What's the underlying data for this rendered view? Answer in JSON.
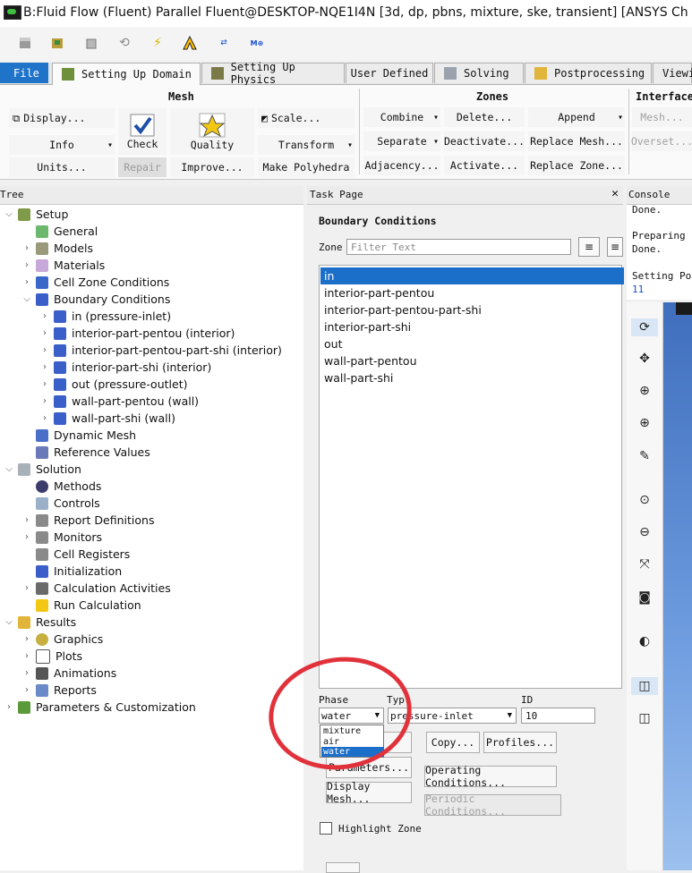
{
  "window": {
    "title": "B:Fluid Flow (Fluent) Parallel Fluent@DESKTOP-NQE1I4N  [3d, dp, pbns, mixture, ske, transient] [ANSYS Ch"
  },
  "quick_toolbar": {
    "icons": [
      "open-case-icon",
      "save-icon",
      "cube-icon",
      "refresh-icon",
      "lightning-icon",
      "ansys-icon",
      "parallel-icon",
      "moe-icon"
    ]
  },
  "tabs": [
    {
      "label": "File"
    },
    {
      "label": "Setting Up Domain"
    },
    {
      "label": "Setting Up Physics"
    },
    {
      "label": "User Defined"
    },
    {
      "label": "Solving"
    },
    {
      "label": "Postprocessing"
    },
    {
      "label": "Viewi"
    }
  ],
  "ribbon": {
    "mesh": {
      "title": "Mesh",
      "display": "Display...",
      "info": "Info",
      "units": "Units...",
      "check": "Check",
      "repair": "Repair",
      "quality": "Quality",
      "improve": "Improve...",
      "scale": "Scale...",
      "transform": "Transform",
      "make_polyhedra": "Make Polyhedra"
    },
    "zones": {
      "title": "Zones",
      "combine": "Combine",
      "separate": "Separate",
      "adjacency": "Adjacency...",
      "delete": "Delete...",
      "deactivate": "Deactivate...",
      "activate": "Activate...",
      "append": "Append",
      "replace_mesh": "Replace Mesh...",
      "replace_zone": "Replace Zone..."
    },
    "interface": {
      "title": "Interface",
      "mesh": "Mesh...",
      "overset": "Overset..."
    }
  },
  "tree": {
    "header": "Tree",
    "nodes": [
      {
        "label": "Setup"
      },
      {
        "label": "General"
      },
      {
        "label": "Models"
      },
      {
        "label": "Materials"
      },
      {
        "label": "Cell Zone Conditions"
      },
      {
        "label": "Boundary Conditions"
      },
      {
        "label": "in (pressure-inlet)"
      },
      {
        "label": "interior-part-pentou (interior)"
      },
      {
        "label": "interior-part-pentou-part-shi (interior)"
      },
      {
        "label": "interior-part-shi (interior)"
      },
      {
        "label": "out (pressure-outlet)"
      },
      {
        "label": "wall-part-pentou (wall)"
      },
      {
        "label": "wall-part-shi (wall)"
      },
      {
        "label": "Dynamic Mesh"
      },
      {
        "label": "Reference Values"
      },
      {
        "label": "Solution"
      },
      {
        "label": "Methods"
      },
      {
        "label": "Controls"
      },
      {
        "label": "Report Definitions"
      },
      {
        "label": "Monitors"
      },
      {
        "label": "Cell Registers"
      },
      {
        "label": "Initialization"
      },
      {
        "label": "Calculation Activities"
      },
      {
        "label": "Run Calculation"
      },
      {
        "label": "Results"
      },
      {
        "label": "Graphics"
      },
      {
        "label": "Plots"
      },
      {
        "label": "Animations"
      },
      {
        "label": "Reports"
      },
      {
        "label": "Parameters & Customization"
      }
    ]
  },
  "task_page": {
    "header": "Task Page",
    "title": "Boundary Conditions",
    "zone_label": "Zone",
    "filter_placeholder": "Filter Text",
    "zones": [
      "in",
      "interior-part-pentou",
      "interior-part-pentou-part-shi",
      "interior-part-shi",
      "out",
      "wall-part-pentou",
      "wall-part-shi"
    ],
    "phase_label": "Phase",
    "type_label": "Typ",
    "id_label": "ID",
    "phase_value": "water",
    "type_value": "pressure-inlet",
    "id_value": "10",
    "phase_options": [
      "mixture",
      "air",
      "water"
    ],
    "buttons": {
      "copy": "Copy...",
      "profiles": "Profiles...",
      "parameters": "Parameters...",
      "operating_conditions": "Operating Conditions...",
      "display_mesh": "Display Mesh...",
      "periodic_conditions": "Periodic Conditions..."
    },
    "highlight_zone": "Highlight Zone"
  },
  "console": {
    "header": "Console",
    "lines": [
      "Done.",
      "",
      "Preparing",
      "Done.",
      "",
      "Setting Po",
      "11"
    ]
  }
}
